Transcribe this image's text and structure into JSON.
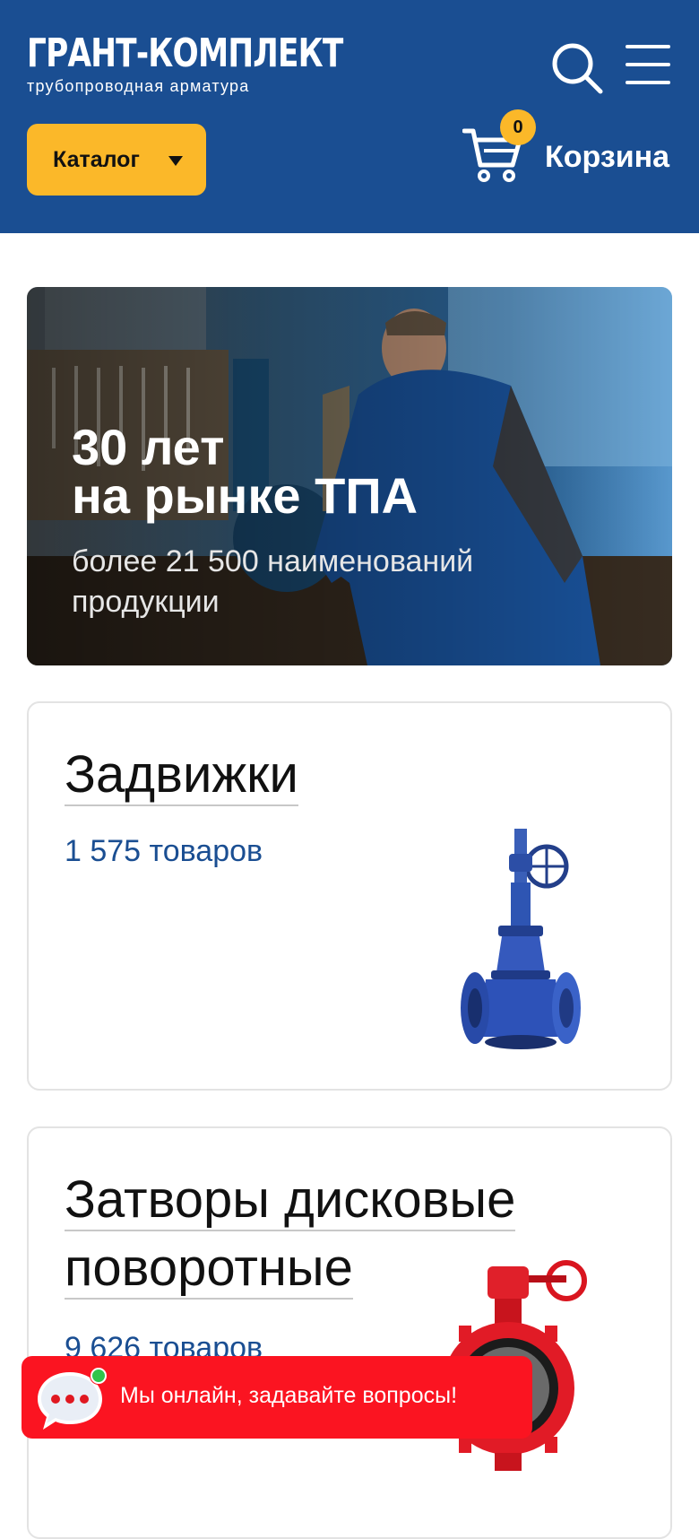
{
  "header": {
    "logo_title": "ГРАНТ-КОМПЛЕКТ",
    "logo_subtitle": "трубопроводная арматура",
    "search_icon": "search-icon",
    "menu_icon": "hamburger-menu-icon",
    "catalog_label": "Каталог",
    "cart_count": "0",
    "cart_label": "Корзина",
    "colors": {
      "header_bg": "#1a4e92",
      "accent": "#fbb829"
    }
  },
  "hero": {
    "title": "30 лет\nна рынке ТПА",
    "subtitle": "более 21 500 наименований продукции"
  },
  "categories": [
    {
      "title": "Задвижки",
      "count": "1 575 товаров",
      "image_icon": "gate-valve-image"
    },
    {
      "title_line1": "Затворы дисковые",
      "title_line2": "поворотные",
      "count": "9 626 товаров",
      "image_icon": "butterfly-valve-image"
    }
  ],
  "chat": {
    "text": "Мы онлайн, задавайте вопросы!",
    "icon": "chat-bubble-icon",
    "status_color": "#2fc44b",
    "bg_color": "#fb1421"
  }
}
